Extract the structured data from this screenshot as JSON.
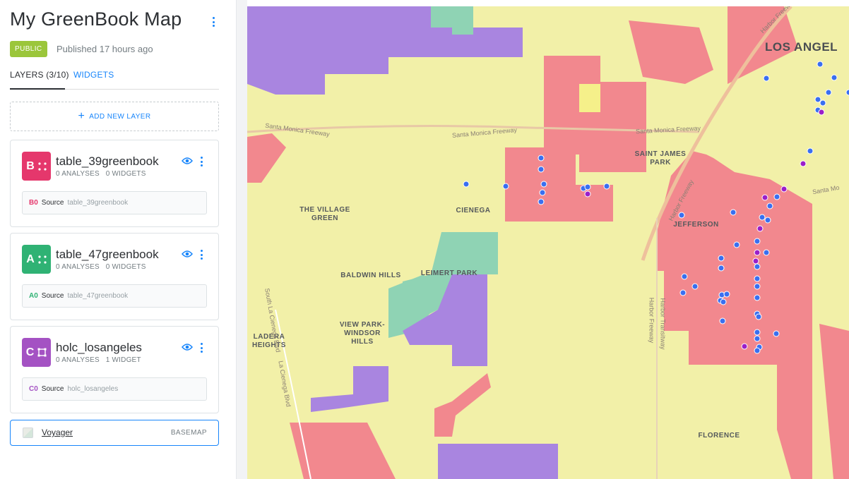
{
  "app": {
    "map_title": "My GreenBook Map",
    "visibility": "PUBLIC",
    "published": "Published 17 hours ago"
  },
  "tabs": [
    {
      "label": "LAYERS (3/10)",
      "active": true
    },
    {
      "label": "WIDGETS",
      "active": false
    }
  ],
  "add_layer_label": "ADD NEW LAYER",
  "layers": [
    {
      "letter": "B",
      "name": "table_39greenbook",
      "analyses": "0 ANALYSES",
      "widgets": "0 WIDGETS",
      "node": "B0",
      "source_label": "Source",
      "source_table": "table_39greenbook",
      "color": "#e5376c",
      "icon": "points-icon"
    },
    {
      "letter": "A",
      "name": "table_47greenbook",
      "analyses": "0 ANALYSES",
      "widgets": "0 WIDGETS",
      "node": "A0",
      "source_label": "Source",
      "source_table": "table_47greenbook",
      "color": "#2fb274",
      "icon": "points-icon"
    },
    {
      "letter": "C",
      "name": "holc_losangeles",
      "analyses": "0 ANALYSES",
      "widgets": "1 WIDGET",
      "node": "C0",
      "source_label": "Source",
      "source_table": "holc_losangeles",
      "color": "#a452c3",
      "icon": "polygon-icon"
    }
  ],
  "basemap": {
    "name": "Voyager",
    "label": "BASEMAP"
  },
  "map": {
    "city_label": "LOS ANGEL",
    "neighborhoods": [
      "SAINT JAMES PARK",
      "THE VILLAGE GREEN",
      "CIENEGA",
      "JEFFERSON",
      "BALDWIN HILLS",
      "LEIMERT PARK",
      "VIEW PARK- WINDSOR HILLS",
      "LADERA HEIGHTS",
      "FLORENCE"
    ],
    "roads": [
      "Santa Monica Freeway",
      "Santa Monica Freeway",
      "Santa Monica Freeway",
      "Harbor Freeway",
      "Harbor Freeway",
      "Harbor Transitway",
      "South La Cienega Blvd",
      "La Cienega Blvd",
      "Santa Mo",
      "Harbor Freew"
    ],
    "colors": {
      "grade_a": "#8fd3b4",
      "grade_b": "#a985e0",
      "grade_c": "#f5f08a",
      "grade_d": "#f2888e",
      "point_blue": "#3a6ff0",
      "point_purple": "#9b1fc9"
    }
  }
}
